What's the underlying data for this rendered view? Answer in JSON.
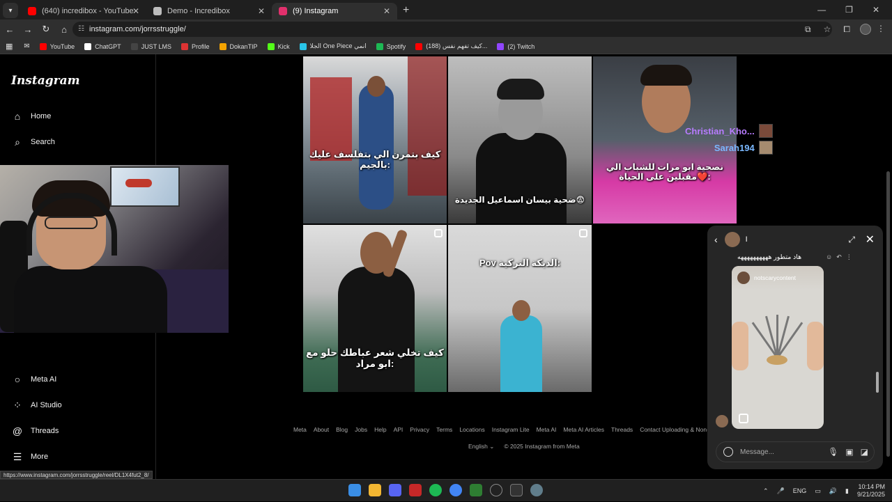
{
  "browser": {
    "tabs": [
      {
        "title": "(640) incredibox - YouTube",
        "color": "#ff0000"
      },
      {
        "title": "Demo - Incredibox",
        "color": "#bdbdbd"
      },
      {
        "title": "(9) Instagram",
        "color": "#e1306c"
      }
    ],
    "url": "instagram.com/jorrsstruggle/",
    "bookmarks": [
      {
        "label": "YouTube",
        "color": "#ff0000"
      },
      {
        "label": "ChatGPT",
        "color": "#ffffff"
      },
      {
        "label": "JUST LMS",
        "color": "#444444"
      },
      {
        "label": "Profile",
        "color": "#d33"
      },
      {
        "label": "DokanTIP",
        "color": "#f4a300"
      },
      {
        "label": "Kick",
        "color": "#53fc18"
      },
      {
        "label": "الجلا One Piece انمي",
        "color": "#29c4e8"
      },
      {
        "label": "Spotify",
        "color": "#1db954"
      },
      {
        "label": "(188) كيف تفهم نفس...",
        "color": "#ff0000"
      },
      {
        "label": "(2) Twitch",
        "color": "#9146ff"
      }
    ],
    "status_url": "https://www.instagram.com/jorrsstruggle/reel/DL1X4fut2_8/"
  },
  "sidebar": {
    "logo": "Instagram",
    "items_top": [
      {
        "label": "Home",
        "icon": "home-icon"
      },
      {
        "label": "Search",
        "icon": "search-icon"
      }
    ],
    "items_bottom": [
      {
        "label": "Meta AI",
        "icon": "meta-ai-icon"
      },
      {
        "label": "AI Studio",
        "icon": "ai-studio-icon"
      },
      {
        "label": "Threads",
        "icon": "threads-icon"
      },
      {
        "label": "More",
        "icon": "menu-icon"
      }
    ]
  },
  "reels": [
    {
      "caption": "كيف بتمرن الي بتفلسف عليك بالجيم:"
    },
    {
      "caption": "ضحية بيسان اسماعيل الجديدة😨"
    },
    {
      "caption": "نصحية ابو مرات للشباب الي مقبلين على الحياة❤️:"
    },
    {
      "caption": "كيف تخلي شعر عباطك حلو مع ابو مراد:"
    },
    {
      "caption": "Pov الدبكة التركية:"
    }
  ],
  "overlay_names": [
    "Christian_Kho...",
    "Sarah194"
  ],
  "footer": {
    "links": [
      "Meta",
      "About",
      "Blog",
      "Jobs",
      "Help",
      "API",
      "Privacy",
      "Terms",
      "Locations",
      "Instagram Lite",
      "Meta AI",
      "Meta AI Articles",
      "Threads",
      "Contact Uploading & Non-Users"
    ],
    "language": "English",
    "copyright": "© 2025 Instagram from Meta"
  },
  "chat": {
    "name": "I",
    "last_text": "هاد متطور ههههههههههه",
    "shared_account": "notscarycontent",
    "placeholder": "Message..."
  },
  "taskbar": {
    "lang": "ENG",
    "time": "10:14 PM",
    "date": "9/21/2025"
  }
}
